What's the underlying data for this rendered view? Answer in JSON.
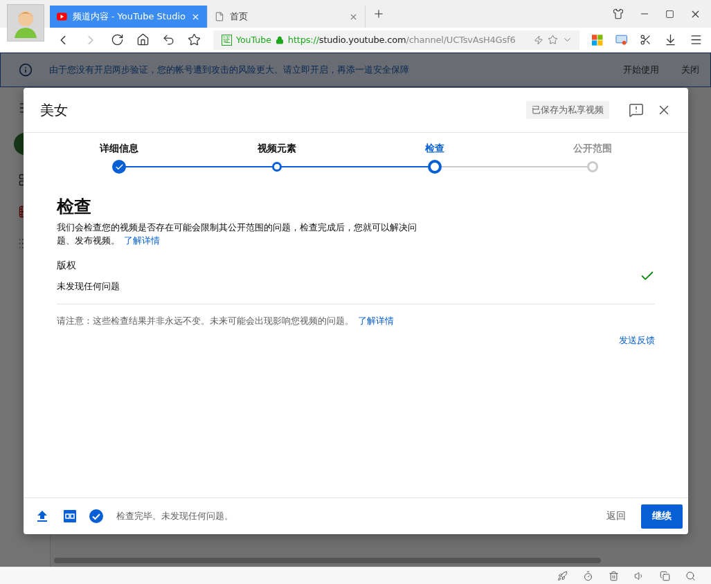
{
  "browser": {
    "tabs": [
      {
        "kind": "youtube",
        "title": "频道内容 - YouTube Studio",
        "selected": true
      },
      {
        "kind": "page",
        "title": "首页",
        "selected": false
      }
    ],
    "address": {
      "cert_mark": "证",
      "site_name": "YouTube",
      "scheme": "https://",
      "host": "studio.youtube.com",
      "path": "/channel/UCTsvAsH4Gsf6"
    }
  },
  "banner": {
    "text": "由于您没有开启两步验证，您的帐号遭到攻击的风险更大。请立即开启，再添一道安全保障",
    "actions": [
      "开始使用",
      "关闭"
    ]
  },
  "dialog": {
    "title": "美女",
    "saved_badge": "已保存为私享视频",
    "steps": [
      {
        "label": "详细信息",
        "kind": "done",
        "selected": false
      },
      {
        "label": "视频元素",
        "kind": "visited",
        "selected": false
      },
      {
        "label": "检查",
        "kind": "visited",
        "selected": true
      },
      {
        "label": "公开范围",
        "kind": "upcoming",
        "selected": false
      }
    ],
    "heading": "检查",
    "description": "我们会检查您的视频是否存在可能会限制其公开范围的问题，检查完成后，您就可以解决问题、发布视频。",
    "description_link": "了解详情",
    "checks": [
      {
        "title": "版权",
        "result": "未发现任何问题",
        "passed": true
      }
    ],
    "note": "请注意：这些检查结果并非永远不变。未来可能会出现影响您视频的问题。",
    "note_link": "了解详情",
    "feedback_link": "发送反馈",
    "footer": {
      "status_text": "检查完毕。未发现任何问题。",
      "back": "返回",
      "next": "继续"
    }
  }
}
